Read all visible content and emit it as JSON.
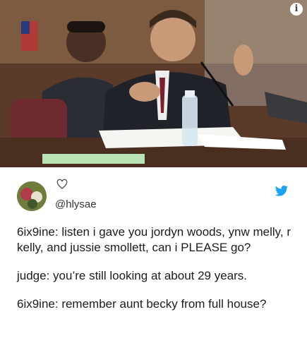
{
  "tweet": {
    "username": "@hlysae",
    "lines": [
      "6ix9ine: listen i gave you jordyn woods, ynw melly, r kelly, and jussie smollett, can i PLEASE go?",
      "judge: you’re still looking at about 29 years.",
      "6ix9ine: remember aunt becky from full house?"
    ]
  },
  "icons": {
    "info": "info-icon",
    "like": "heart-icon",
    "brand": "twitter-bird-icon"
  },
  "colors": {
    "twitter_blue": "#1da1f2",
    "text": "#1c1c1c"
  }
}
